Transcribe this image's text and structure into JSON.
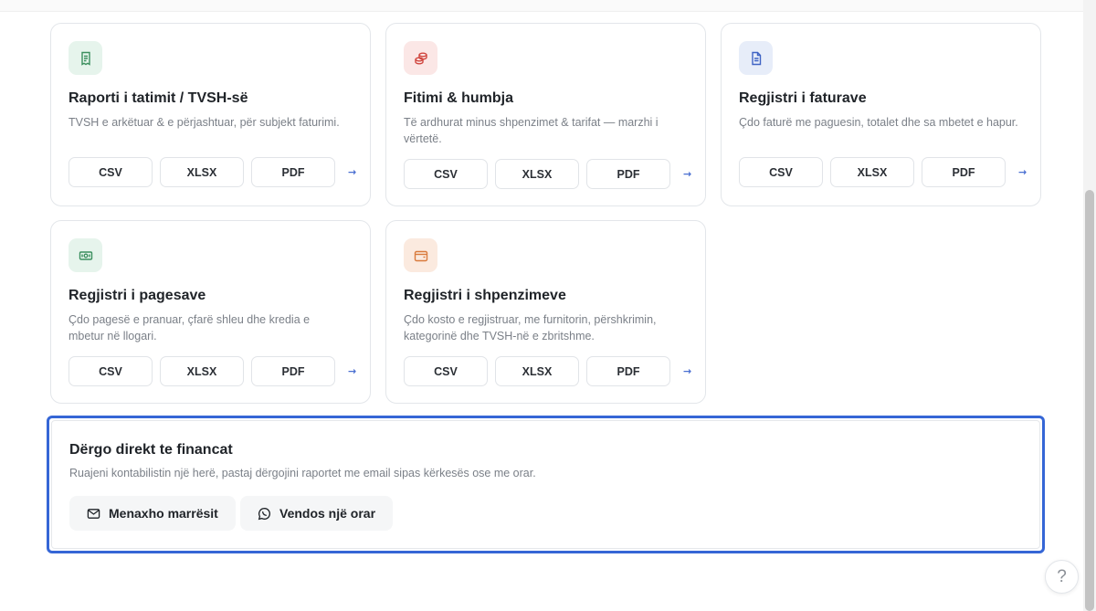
{
  "cards": [
    {
      "title": "Raporti i tatimit / TVSH-së",
      "desc": "TVSH e arkëtuar & e përjashtuar, për subjekt faturimi.",
      "icon": "receipt-icon",
      "icon_bg": "#e6f4ec",
      "icon_color": "#3b8f5e",
      "buttons": [
        "CSV",
        "XLSX",
        "PDF"
      ],
      "arrow": "→"
    },
    {
      "title": "Fitimi & humbja",
      "desc": "Të ardhurat minus shpenzimet & tarifat — marzhi i vërtetë.",
      "icon": "coins-icon",
      "icon_bg": "#fbe7e6",
      "icon_color": "#d0453e",
      "buttons": [
        "CSV",
        "XLSX",
        "PDF"
      ],
      "arrow": "→"
    },
    {
      "title": "Regjistri i faturave",
      "desc": "Çdo faturë me paguesin, totalet dhe sa mbetet e hapur.",
      "icon": "document-icon",
      "icon_bg": "#e7edf9",
      "icon_color": "#3f63c4",
      "buttons": [
        "CSV",
        "XLSX",
        "PDF"
      ],
      "arrow": "→"
    },
    {
      "title": "Regjistri i pagesave",
      "desc": "Çdo pagesë e pranuar, çfarë shleu dhe kredia e mbetur në llogari.",
      "icon": "cash-icon",
      "icon_bg": "#e6f4ec",
      "icon_color": "#3b8f5e",
      "buttons": [
        "CSV",
        "XLSX",
        "PDF"
      ],
      "arrow": "→"
    },
    {
      "title": "Regjistri i shpenzimeve",
      "desc": "Çdo kosto e regjistruar, me furnitorin, përshkrimin, kategorinë dhe TVSH-në e zbritshme.",
      "icon": "wallet-icon",
      "icon_bg": "#fbeadf",
      "icon_color": "#d97a3c",
      "buttons": [
        "CSV",
        "XLSX",
        "PDF"
      ],
      "arrow": "→"
    }
  ],
  "send": {
    "title": "Dërgo direkt te financat",
    "desc": "Ruajeni kontabilistin një herë, pastaj dërgojini raportet me email sipas kërkesës ose me orar.",
    "manage_label": "Menaxho marrësit",
    "schedule_label": "Vendos një orar",
    "accent": "#3566d6"
  },
  "help": {
    "label": "?"
  }
}
